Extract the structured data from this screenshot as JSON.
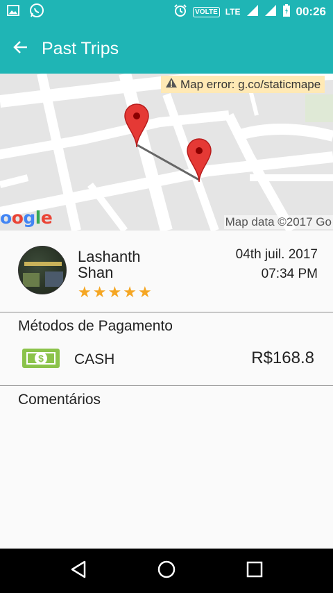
{
  "status_bar": {
    "volte": "VOLTE",
    "network": "LTE",
    "time": "00:26",
    "icons": [
      "image-icon",
      "whatsapp-icon",
      "alarm-icon",
      "signal-icon",
      "signal-icon",
      "battery-charging-icon"
    ]
  },
  "header": {
    "title": "Past Trips",
    "back_icon": "arrow-left-icon"
  },
  "map": {
    "error_text": "Map error: g.co/staticmape",
    "logo_text": "oogle",
    "attribution": "Map data ©2017 Go",
    "markers": [
      "map-pin-icon",
      "map-pin-icon"
    ]
  },
  "trip": {
    "driver_name": "Lashanth Shan",
    "rating": 5,
    "date": "04th juil. 2017",
    "time": "07:34 PM"
  },
  "payment": {
    "title": "Métodos de Pagamento",
    "method": "CASH",
    "amount": "R$168.8",
    "icon": "cash-icon"
  },
  "comments": {
    "title": "Comentários"
  },
  "nav": {
    "icons": [
      "back-triangle-icon",
      "home-circle-icon",
      "recents-square-icon"
    ]
  },
  "colors": {
    "primary": "#1fb5b5",
    "star": "#f5a623",
    "cash": "#8bc34a",
    "marker": "#e53935"
  }
}
